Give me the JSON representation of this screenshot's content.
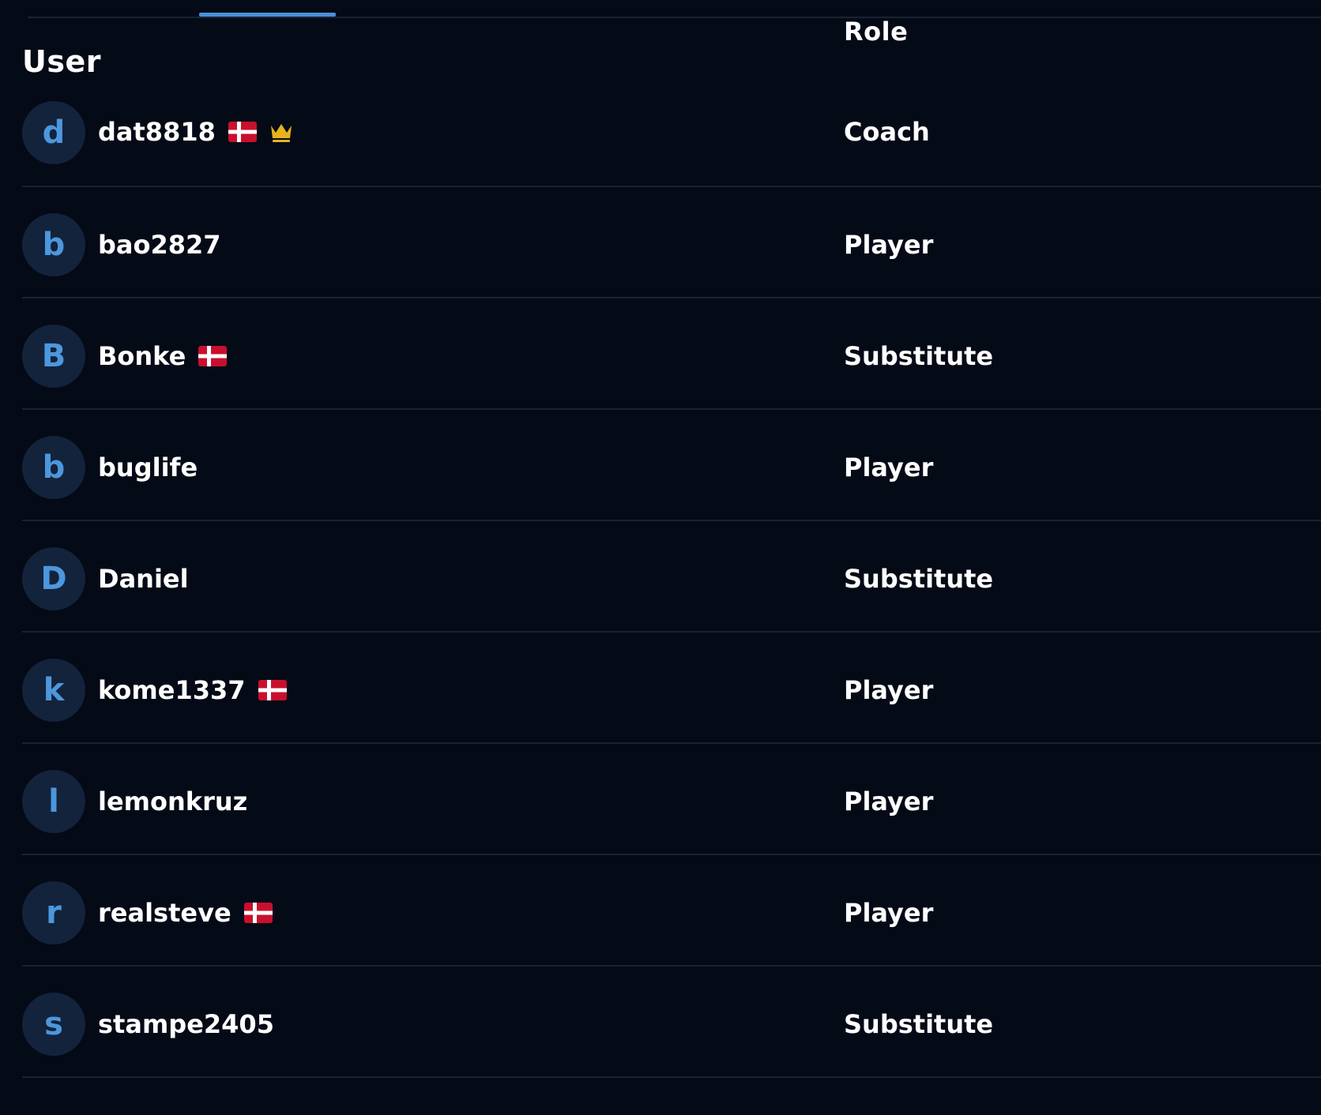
{
  "table": {
    "headers": {
      "user": "User",
      "role": "Role"
    },
    "rows": [
      {
        "initial": "d",
        "name": "dat8818",
        "flag": true,
        "crown": true,
        "role": "Coach"
      },
      {
        "initial": "b",
        "name": "bao2827",
        "flag": false,
        "crown": false,
        "role": "Player"
      },
      {
        "initial": "B",
        "name": "Bonke",
        "flag": true,
        "crown": false,
        "role": "Substitute"
      },
      {
        "initial": "b",
        "name": "buglife",
        "flag": false,
        "crown": false,
        "role": "Player"
      },
      {
        "initial": "D",
        "name": "Daniel",
        "flag": false,
        "crown": false,
        "role": "Substitute"
      },
      {
        "initial": "k",
        "name": "kome1337",
        "flag": true,
        "crown": false,
        "role": "Player"
      },
      {
        "initial": "l",
        "name": "lemonkruz",
        "flag": false,
        "crown": false,
        "role": "Player"
      },
      {
        "initial": "r",
        "name": "realsteve",
        "flag": true,
        "crown": false,
        "role": "Player"
      },
      {
        "initial": "s",
        "name": "stampe2405",
        "flag": false,
        "crown": false,
        "role": "Substitute"
      }
    ]
  },
  "icons": {
    "flag": "denmark-flag-icon",
    "crown": "crown-icon"
  },
  "colors": {
    "background": "#050a17",
    "accent": "#4a90d9",
    "flag_red": "#c8102e",
    "crown": "#e8b21c"
  }
}
